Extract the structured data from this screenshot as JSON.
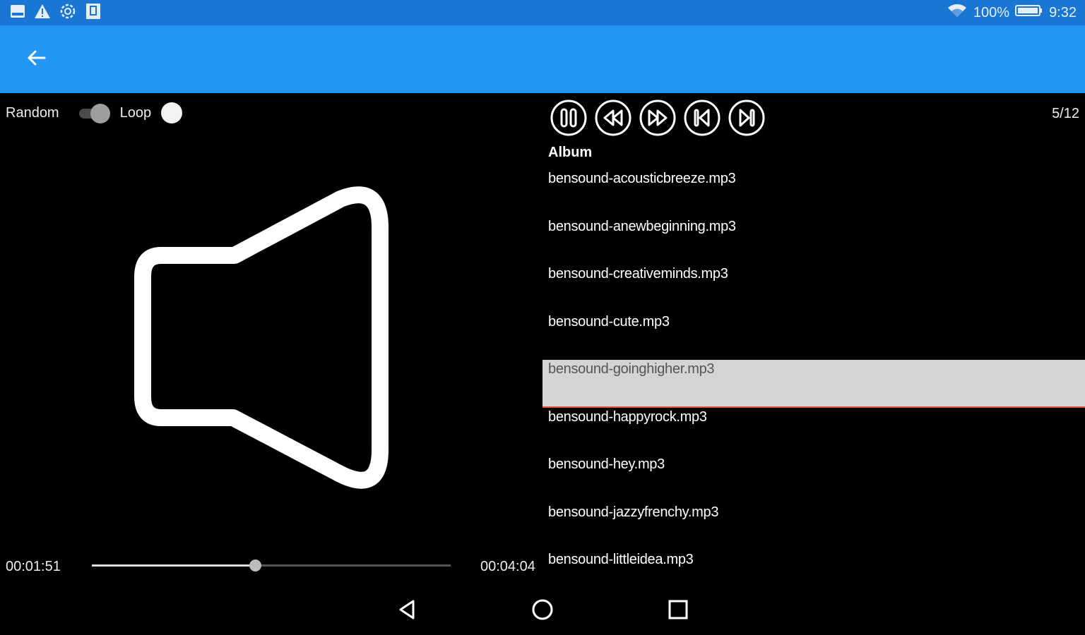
{
  "status_bar": {
    "left_icons": [
      "image-icon",
      "warning-icon",
      "settings-gear-icon",
      "clipboard-icon"
    ],
    "wifi_icon": "wifi-icon",
    "battery_percent": "100%",
    "battery_icon": "battery-icon",
    "time": "9:32"
  },
  "app_bar": {
    "back_icon": "arrow-back-icon",
    "color": "#2196f3"
  },
  "toggles": {
    "random_label": "Random",
    "random_on": false,
    "loop_label": "Loop",
    "loop_on": true
  },
  "artwork": {
    "icon": "speaker-icon"
  },
  "seek": {
    "current_time": "00:01:51",
    "total_time": "00:04:04",
    "progress": 0.455
  },
  "controls": {
    "buttons": [
      {
        "name": "pause-icon"
      },
      {
        "name": "rewind-icon"
      },
      {
        "name": "fast-forward-icon"
      },
      {
        "name": "skip-previous-icon"
      },
      {
        "name": "skip-next-icon"
      }
    ],
    "counter": "5/12"
  },
  "playlist": {
    "album_label": "Album",
    "tracks": [
      "bensound-acousticbreeze.mp3",
      "bensound-anewbeginning.mp3",
      "bensound-creativeminds.mp3",
      "bensound-cute.mp3",
      "bensound-goinghigher.mp3",
      "bensound-happyrock.mp3",
      "bensound-hey.mp3",
      "bensound-jazzyfrenchy.mp3",
      "bensound-littleidea.mp3"
    ],
    "selected_index": 4,
    "selected_color": "#d4d4d4",
    "selected_underline": "#e4572e"
  },
  "nav_bar": {
    "back_icon": "nav-back-icon",
    "home_icon": "nav-home-icon",
    "recents_icon": "nav-recents-icon"
  }
}
